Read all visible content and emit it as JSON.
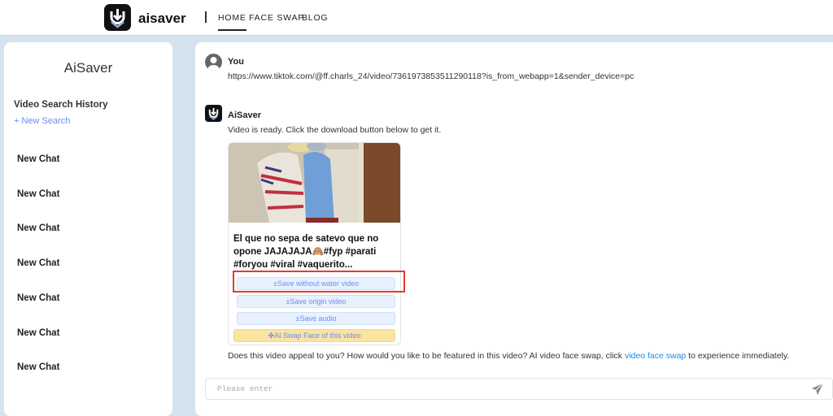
{
  "header": {
    "brand": "aisaver",
    "nav": [
      {
        "label": "HOME",
        "active": true
      },
      {
        "label": "FACE SWAP"
      },
      {
        "label": "BLOG"
      }
    ]
  },
  "sidebar": {
    "title": "AiSaver",
    "history_label": "Video Search History",
    "new_search": "+ New Search",
    "chats": [
      "New Chat",
      "New Chat",
      "New Chat",
      "New Chat",
      "New Chat",
      "New Chat",
      "New Chat"
    ]
  },
  "messages": {
    "user": {
      "name": "You",
      "text": "https://www.tiktok.com/@ff.charls_24/video/7361973853511290118?is_from_webapp=1&sender_device=pc"
    },
    "bot": {
      "name": "AiSaver",
      "text": "Video is ready. Click the download button below to get it."
    }
  },
  "video": {
    "title": "El que no sepa de satevo que no opone JAJAJAJA🙈#fyp #parati #foryou #viral #vaquerito...",
    "buttons": {
      "no_watermark": "±Save without water video",
      "origin": "±Save origin video",
      "audio": "±Save audio",
      "swap": "AI Swap Face of this video"
    }
  },
  "footer": {
    "before": "Does this video appeal to you? How would you like to be featured in this video? AI video face swap, click ",
    "link": "video face swap",
    "after": " to experience immediately."
  },
  "input": {
    "placeholder": "Please enter",
    "value": ""
  },
  "colors": {
    "accent": "#6a8df5",
    "link": "#1e88e5",
    "highlight": "#e53935",
    "swap_button": "#fbe3a0",
    "background": "#d5e3f1"
  }
}
